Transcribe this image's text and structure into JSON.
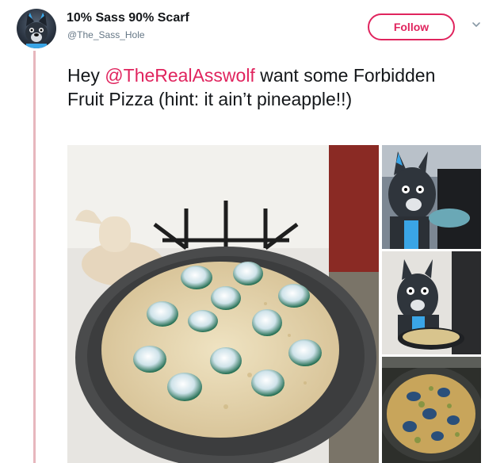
{
  "tweet": {
    "display_name": "10% Sass 90% Scarf",
    "handle": "@The_Sass_Hole",
    "follow_label": "Follow",
    "text_before": "Hey ",
    "mention": "@TheRealAsswolf",
    "text_after": " want some Forbidden Fruit Pizza (hint: it ain’t pineapple!!)"
  },
  "colors": {
    "accent": "#e0245e",
    "thread_line": "#e7b7bd",
    "secondary_text": "#657786"
  },
  "icons": {
    "more": "chevron-down-icon"
  }
}
